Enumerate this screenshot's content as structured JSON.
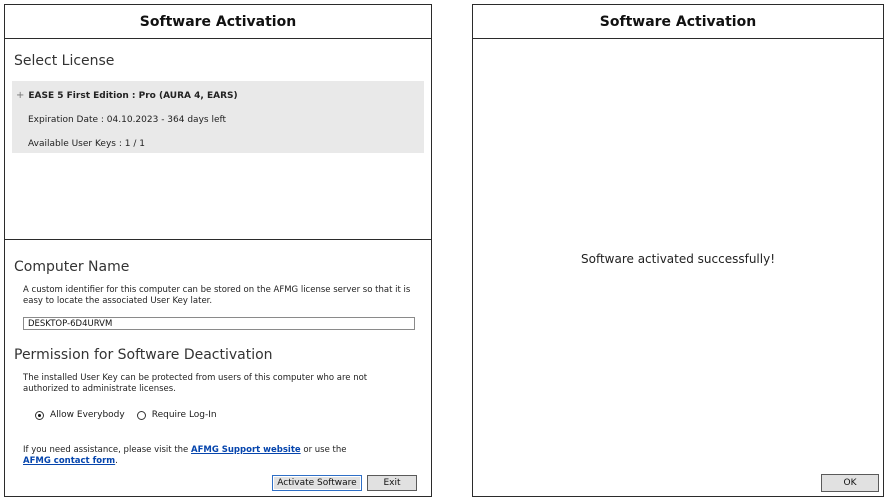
{
  "left_dialog": {
    "title": "Software Activation",
    "select_license": {
      "title": "Select License",
      "product": "EASE 5 First Edition : Pro (AURA 4, EARS)",
      "expiration": "Expiration Date : 04.10.2023 - 364 days left",
      "user_keys": "Available User Keys : 1 / 1"
    },
    "computer_name": {
      "title": "Computer Name",
      "description": "A custom identifier for this computer can be stored on the AFMG license server so that it is easy to locate the associated User Key later.",
      "value": "DESKTOP-6D4URVM"
    },
    "permission": {
      "title": "Permission for Software Deactivation",
      "description": "The installed User Key can be protected from users of this computer who are not authorized to administrate licenses.",
      "options": [
        "Allow Everybody",
        "Require Log-In"
      ],
      "selected": "Allow Everybody"
    },
    "help": {
      "prefix": "If you need assistance, please visit the ",
      "support_link": "AFMG Support website",
      "middle": " or use the",
      "contact_link": "AFMG contact form",
      "suffix": "."
    },
    "buttons": {
      "activate": "Activate Software",
      "exit": "Exit"
    }
  },
  "right_dialog": {
    "title": "Software Activation",
    "message": "Software activated successfully!",
    "ok": "OK"
  }
}
